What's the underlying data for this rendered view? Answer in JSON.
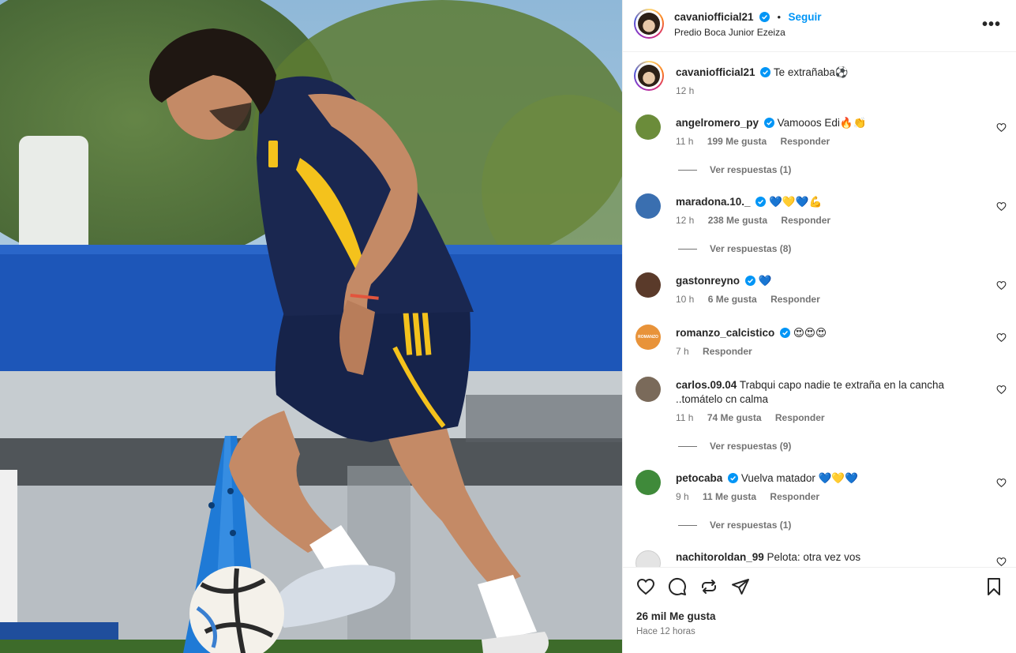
{
  "post": {
    "author": "cavaniofficial21",
    "follow_label": "Seguir",
    "dot": "•",
    "location": "Predio Boca Junior Ezeiza",
    "more_label": "•••",
    "caption": "Te extrañaba⚽",
    "caption_time": "12 h",
    "likes": "26 mil Me gusta",
    "posted": "Hace 12 horas"
  },
  "comments": [
    {
      "user": "angelromero_py",
      "verified": true,
      "text": "Vamooos Edi🔥👏",
      "time": "11 h",
      "likes": "199 Me gusta",
      "reply": "Responder",
      "replies": "Ver respuestas (1)",
      "avatar": "#6b8c3a"
    },
    {
      "user": "maradona.10._",
      "verified": true,
      "text": "💙💛💙💪",
      "time": "12 h",
      "likes": "238 Me gusta",
      "reply": "Responder",
      "replies": "Ver respuestas (8)",
      "avatar": "#3a6fb0"
    },
    {
      "user": "gastonreyno",
      "verified": true,
      "text": "💙",
      "time": "10 h",
      "likes": "6 Me gusta",
      "reply": "Responder",
      "replies": "",
      "avatar": "#5a3a2a"
    },
    {
      "user": "romanzo_calcistico",
      "verified": true,
      "text": "😍😍😍",
      "time": "7 h",
      "likes": "",
      "reply": "Responder",
      "replies": "",
      "avatar": "#e8933a",
      "avatar_text": "ROMANZO"
    },
    {
      "user": "carlos.09.04",
      "verified": false,
      "text": "Trabqui capo nadie te extraña en la cancha ..tomátelo cn calma",
      "time": "11 h",
      "likes": "74 Me gusta",
      "reply": "Responder",
      "replies": "Ver respuestas (9)",
      "avatar": "#7a6a5a"
    },
    {
      "user": "petocaba",
      "verified": true,
      "text": "Vuelva matador 💙💛💙",
      "time": "9 h",
      "likes": "11 Me gusta",
      "reply": "Responder",
      "replies": "Ver respuestas (1)",
      "avatar": "#3f8a3a"
    },
    {
      "user": "nachitoroldan_99",
      "verified": false,
      "text": "Pelota: otra vez vos",
      "time": "",
      "likes": "",
      "reply": "",
      "replies": "",
      "avatar": "#d8d8d8"
    }
  ],
  "colors": {
    "accent": "#0095f6",
    "verified": "#0095f6",
    "muted": "#737373"
  },
  "icons": [
    "verified-badge-icon",
    "more-options-icon",
    "heart-icon",
    "comment-icon",
    "share-icon",
    "send-icon",
    "bookmark-icon"
  ]
}
